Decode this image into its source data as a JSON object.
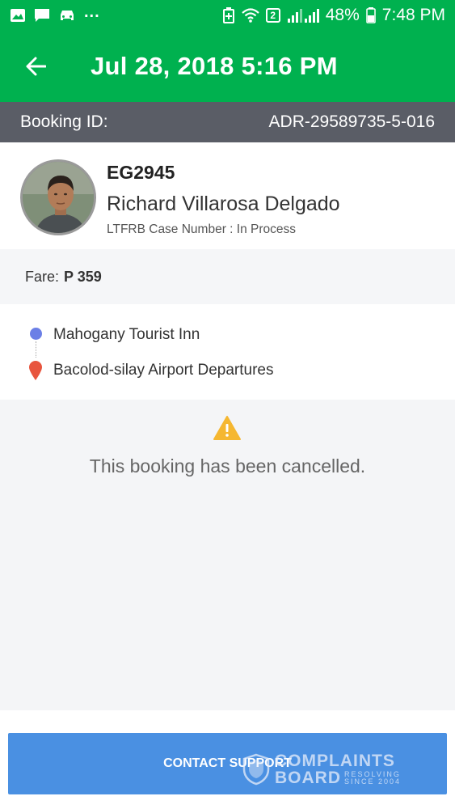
{
  "status_bar": {
    "battery": "48%",
    "time": "7:48 PM",
    "sim_badge": "2",
    "more": "...",
    "icons": [
      "image-icon",
      "message-icon",
      "car-icon",
      "battery-saver-icon",
      "wifi-icon",
      "signal-icon",
      "battery-icon"
    ]
  },
  "header": {
    "title": "Jul 28, 2018 5:16 PM",
    "back_icon": "back-arrow-icon",
    "color": "#00b14f"
  },
  "booking": {
    "label": "Booking ID:",
    "id": "ADR-29589735-5-016"
  },
  "driver": {
    "plate": "EG2945",
    "name": "Richard Villarosa Delgado",
    "ltfrb": "LTFRB Case Number : In Process"
  },
  "fare": {
    "label": "Fare:",
    "value": "P 359"
  },
  "route": {
    "pickup": "Mahogany Tourist Inn",
    "dropoff": "Bacolod-silay Airport Departures",
    "pickup_color": "#6b7fe6",
    "dropoff_color": "#e8553e"
  },
  "status": {
    "message": "This booking has been cancelled.",
    "icon": "warning-icon",
    "icon_color": "#f5b731"
  },
  "actions": {
    "contact_support": "CONTACT SUPPORT",
    "button_color": "#4a90e2"
  },
  "watermark": {
    "brand_top": "COMPLAINTS",
    "brand_bottom": "BOARD",
    "tag_line1": "RESOLVING",
    "tag_line2": "SINCE 2004"
  }
}
